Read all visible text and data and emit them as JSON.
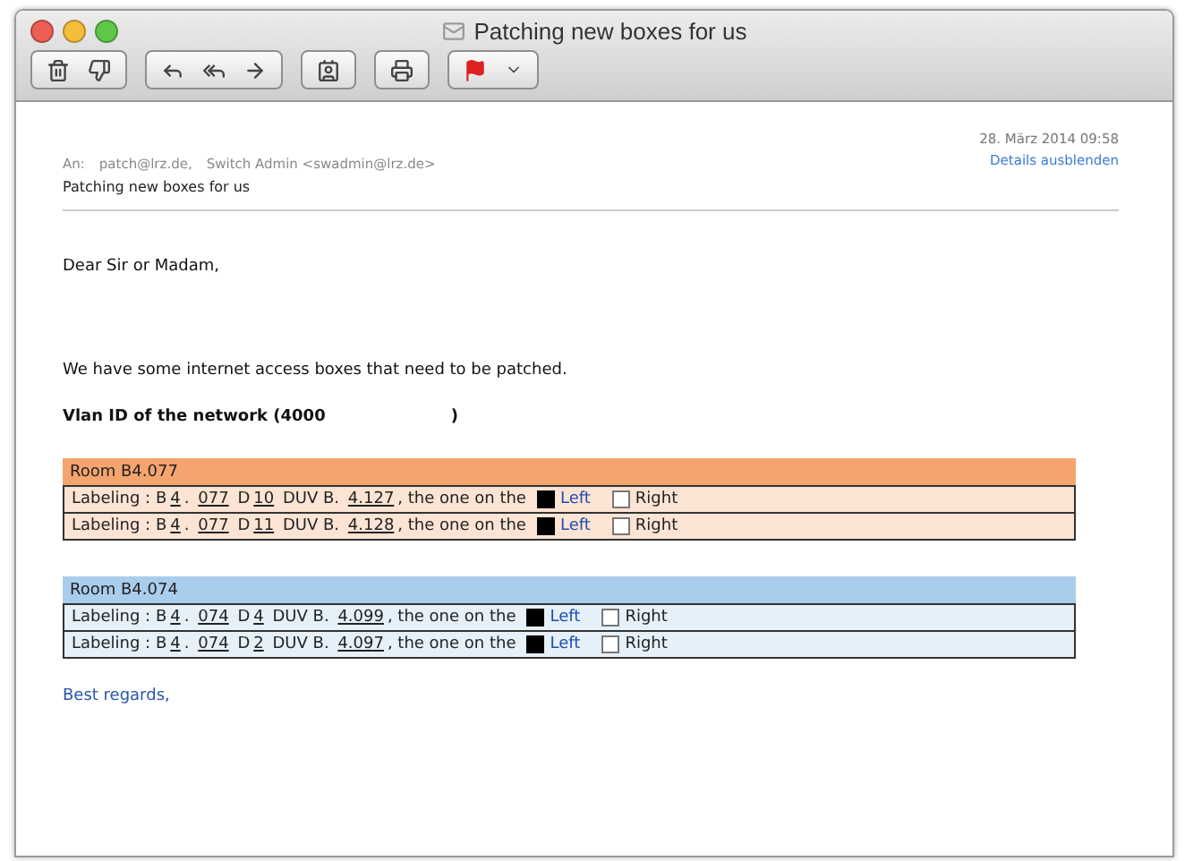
{
  "window": {
    "title": "Patching new boxes for us"
  },
  "header": {
    "to_label": "An:",
    "recipients": [
      "patch@lrz.de,",
      "Switch Admin <swadmin@lrz.de>"
    ],
    "subject": "Patching new boxes for us",
    "date": "28. März 2014 09:58",
    "details_link": "Details ausblenden"
  },
  "body": {
    "greeting": "Dear Sir or Madam,",
    "intro": "We have some internet access boxes that need to be patched.",
    "vlan_label": "Vlan ID of the network (4000",
    "vlan_close": ")",
    "rooms": [
      {
        "title": "Room B4.077",
        "color": "#f5a46e",
        "rows": [
          {
            "prefix": "Labeling : B",
            "building": "4",
            "dot": ".",
            "room": "077",
            "door_prefix": "D",
            "door": "10",
            "duv_prefix": "DUV B.",
            "duv": "4.127",
            "suffix": ", the one on the",
            "options": [
              {
                "label": "Left",
                "checked": true
              },
              {
                "label": "Right",
                "checked": false
              }
            ]
          },
          {
            "prefix": "Labeling : B",
            "building": "4",
            "dot": ".",
            "room": "077",
            "door_prefix": "D",
            "door": "11",
            "duv_prefix": "DUV B.",
            "duv": "4.128",
            "suffix": ", the one on the",
            "options": [
              {
                "label": "Left",
                "checked": true
              },
              {
                "label": "Right",
                "checked": false
              }
            ]
          }
        ]
      },
      {
        "title": "Room B4.074",
        "color": "#a9cdec",
        "rows": [
          {
            "prefix": "Labeling : B",
            "building": "4",
            "dot": ".",
            "room": "074",
            "door_prefix": "D",
            "door": "4",
            "duv_prefix": "DUV B.",
            "duv": "4.099",
            "suffix": ", the one on the",
            "options": [
              {
                "label": "Left",
                "checked": true
              },
              {
                "label": "Right",
                "checked": false
              }
            ]
          },
          {
            "prefix": "Labeling : B",
            "building": "4",
            "dot": ".",
            "room": "074",
            "door_prefix": "D",
            "door": "2",
            "duv_prefix": "DUV B.",
            "duv": "4.097",
            "suffix": ", the one on the",
            "options": [
              {
                "label": "Left",
                "checked": true
              },
              {
                "label": "Right",
                "checked": false
              }
            ]
          }
        ]
      }
    ],
    "closing": "Best regards,"
  }
}
